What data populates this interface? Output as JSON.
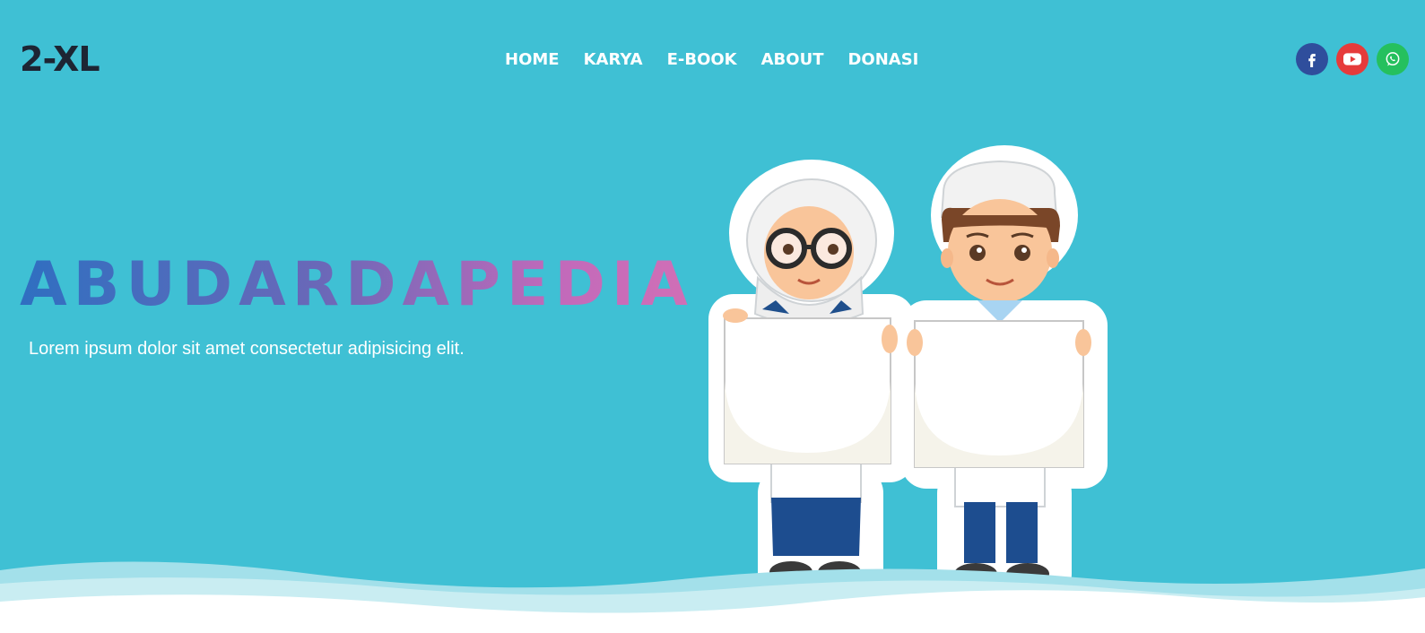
{
  "brand": {
    "name": "2-XL"
  },
  "nav": {
    "items": [
      {
        "label": "HOME"
      },
      {
        "label": "KARYA"
      },
      {
        "label": "E-BOOK"
      },
      {
        "label": "ABOUT"
      },
      {
        "label": "DONASI"
      }
    ]
  },
  "social": {
    "facebook": {
      "icon": "facebook-icon",
      "color": "#2f4e9c"
    },
    "youtube": {
      "icon": "youtube-icon",
      "color": "#e63b3b"
    },
    "whatsapp": {
      "icon": "whatsapp-icon",
      "color": "#25c05e"
    }
  },
  "hero": {
    "title": "ABUDARDAPEDIA",
    "subtitle": "Lorem ipsum dolor sit amet consectetur adipisicing elit.",
    "background": "#3fc0d4",
    "title_gradient": [
      "#2f6fc1",
      "#d16fb6"
    ]
  }
}
